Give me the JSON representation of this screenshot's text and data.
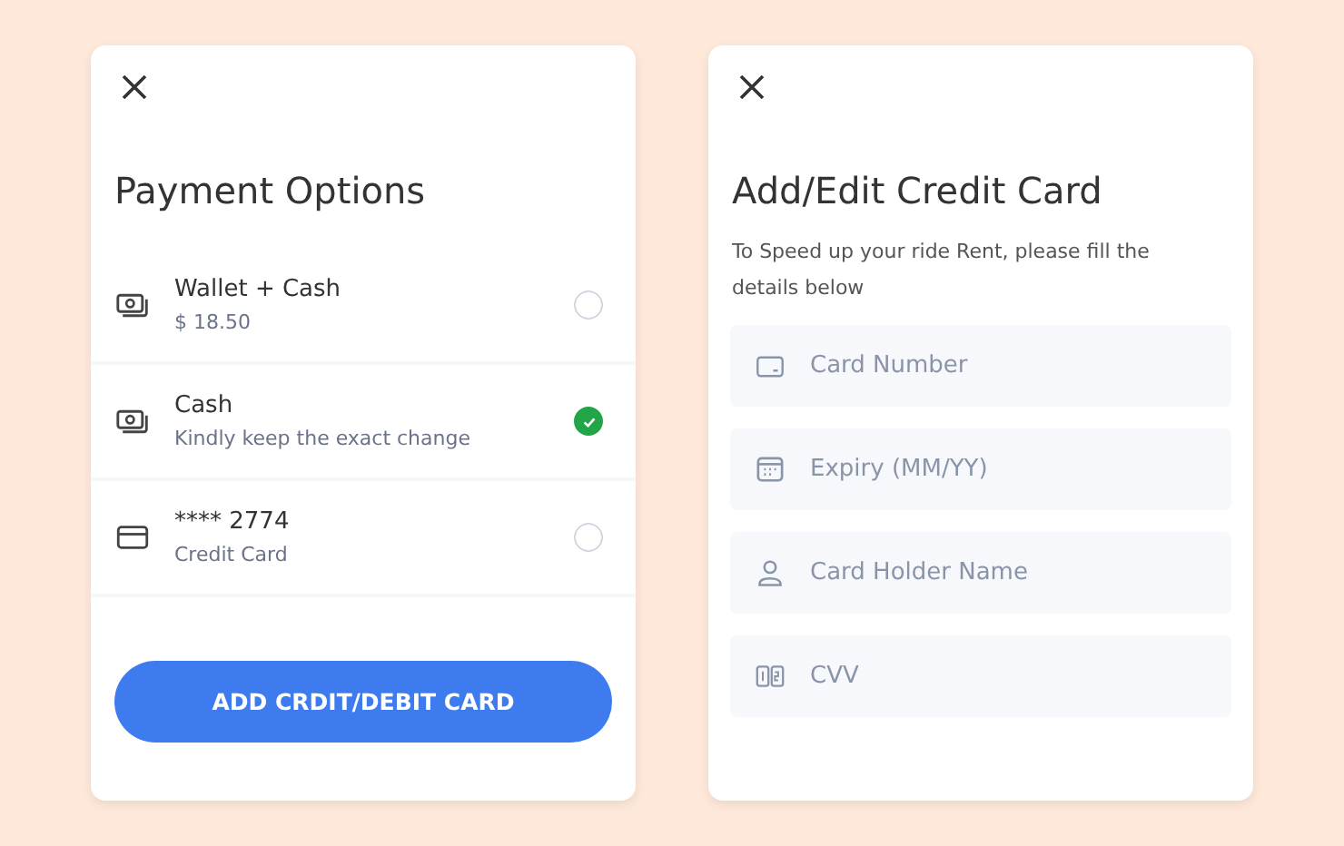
{
  "payment": {
    "title": "Payment Options",
    "options": [
      {
        "kind": "cash",
        "title": "Wallet + Cash",
        "subtitle": "$ 18.50",
        "selected": false
      },
      {
        "kind": "cash",
        "title": "Cash",
        "subtitle": "Kindly keep the exact change",
        "selected": true
      },
      {
        "kind": "card",
        "title": "**** 2774",
        "subtitle": "Credit Card",
        "selected": false
      }
    ],
    "button": "ADD CRDIT/DEBIT CARD"
  },
  "card_form": {
    "title": "Add/Edit Credit Card",
    "description": "To Speed up your ride Rent, please fill the details below",
    "fields": [
      {
        "kind": "card",
        "placeholder": "Card Number"
      },
      {
        "kind": "calendar",
        "placeholder": "Expiry (MM/YY)"
      },
      {
        "kind": "person",
        "placeholder": "Card Holder Name"
      },
      {
        "kind": "cvv",
        "placeholder": "CVV"
      }
    ]
  }
}
